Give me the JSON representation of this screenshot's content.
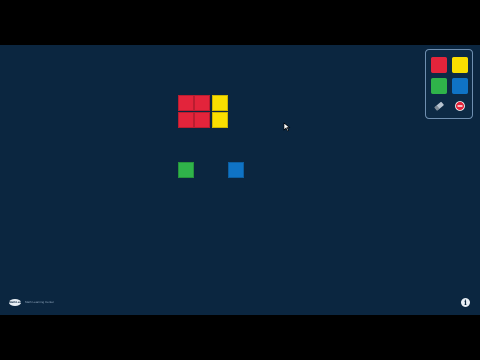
{
  "colors": {
    "background": "#0b2640",
    "frame": "#000000",
    "red": "#e3243b",
    "yellow": "#f9df00",
    "green": "#2fb34a",
    "blue": "#0f73c5"
  },
  "canvas": {
    "tiles": [
      {
        "color": "red"
      },
      {
        "color": "red"
      },
      {
        "color": "yellow"
      },
      {
        "color": "red"
      },
      {
        "color": "red"
      },
      {
        "color": "yellow"
      },
      {
        "color": "green"
      },
      {
        "color": "blue"
      }
    ]
  },
  "palette": {
    "swatches": [
      {
        "color": "red"
      },
      {
        "color": "yellow"
      },
      {
        "color": "green"
      },
      {
        "color": "blue"
      }
    ],
    "tools": [
      "eraser-icon",
      "clear-icon"
    ]
  },
  "footer": {
    "brand_logo_text": "MathLearning",
    "brand_text": "Math Learning Center",
    "info_glyph": "i"
  }
}
